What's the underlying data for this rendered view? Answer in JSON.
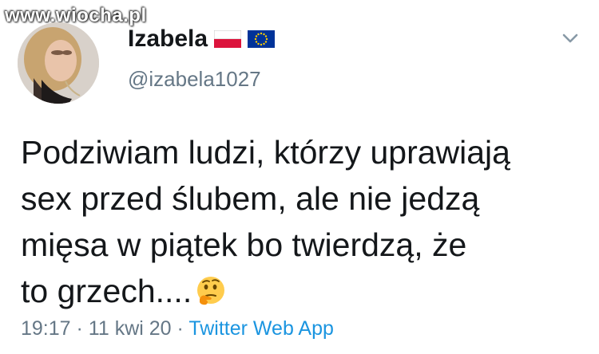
{
  "watermark": "www.wiocha.pl",
  "user": {
    "display_name": "Izabela",
    "handle": "@izabela1027",
    "flags": [
      "poland-flag-icon",
      "eu-flag-icon"
    ]
  },
  "tweet": {
    "text": "Podziwiam ludzi, którzy uprawiają\nsex przed ślubem, ale nie jedzą\nmięsa w piątek bo twierdzą, że\nto grzech....",
    "emoji": "thinking-face-icon",
    "time": "19:17",
    "separator": "·",
    "date": "11 kwi 20",
    "source": "Twitter Web App"
  },
  "colors": {
    "text": "#14171a",
    "secondary": "#657786",
    "link": "#1b95e0"
  }
}
